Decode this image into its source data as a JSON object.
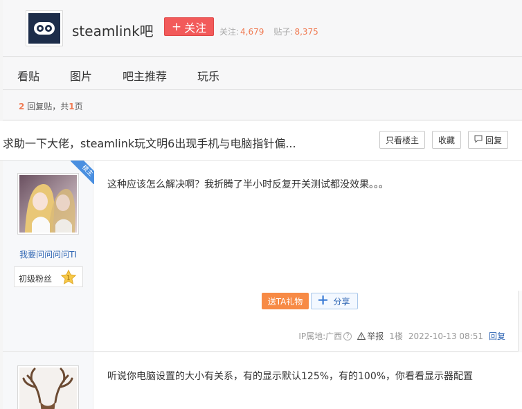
{
  "forum": {
    "name": "steamlink吧",
    "follow_label": "关注",
    "stats": {
      "followers_label": "关注:",
      "followers": "4,679",
      "posts_label": "贴子:",
      "posts": "8,375"
    },
    "logo_icon": "gamepad-icon"
  },
  "nav": {
    "tabs": [
      "看贴",
      "图片",
      "吧主推荐",
      "玩乐"
    ]
  },
  "count_bar": {
    "reply_count": "2",
    "reply_text": "回复贴，共",
    "page_count": "1",
    "page_suffix": "页"
  },
  "thread": {
    "title": "求助一下大佬，steamlink玩文明6出现手机与电脑指针偏...",
    "buttons": {
      "only_op": "只看楼主",
      "favorite": "收藏",
      "reply": "回复"
    }
  },
  "posts": [
    {
      "badge": "楼主",
      "user": "我要问问问问TI",
      "level_name": "初级粉丝",
      "level": "1",
      "content": "这种应该怎么解决啊？我折腾了半小时反复开关测试都没效果。。。",
      "gift_label": "送TA礼物",
      "share_label": "分享",
      "ip": "IP属地:广西",
      "report": "举报",
      "floor": "1楼",
      "time": "2022-10-13 08:51",
      "reply": "回复"
    },
    {
      "content": "听说你电脑设置的大小有关系，有的显示默认125%，有的100%，你看看显示器配置"
    }
  ],
  "colors": {
    "accent_red": "#f25a5a",
    "accent_orange": "#f07a52",
    "link_blue": "#2d64b3",
    "badge_blue": "#4a8fe0"
  }
}
